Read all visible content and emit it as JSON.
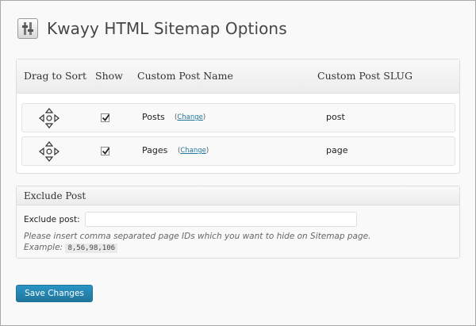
{
  "header": {
    "title": "Kwayy HTML Sitemap Options",
    "icon": "settings-sliders-icon"
  },
  "table": {
    "columns": [
      "Drag to Sort",
      "Show",
      "Custom Post Name",
      "Custom Post SLUG"
    ],
    "rows": [
      {
        "name": "Posts",
        "change_label": "Change",
        "slug": "post",
        "show": true,
        "drag_icon": "move-arrows-icon"
      },
      {
        "name": "Pages",
        "change_label": "Change",
        "slug": "page",
        "show": true,
        "drag_icon": "move-arrows-icon"
      }
    ]
  },
  "exclude": {
    "title": "Exclude Post",
    "label": "Exclude post:",
    "value": "",
    "description": "Please insert comma separated page IDs which you want to hide on Sitemap page.",
    "example_label": "Example:",
    "example_code": "8,56,98,106"
  },
  "save_label": "Save Changes",
  "colors": {
    "button": "#21759b",
    "link": "#21759b",
    "background": "#f9f9f9"
  }
}
